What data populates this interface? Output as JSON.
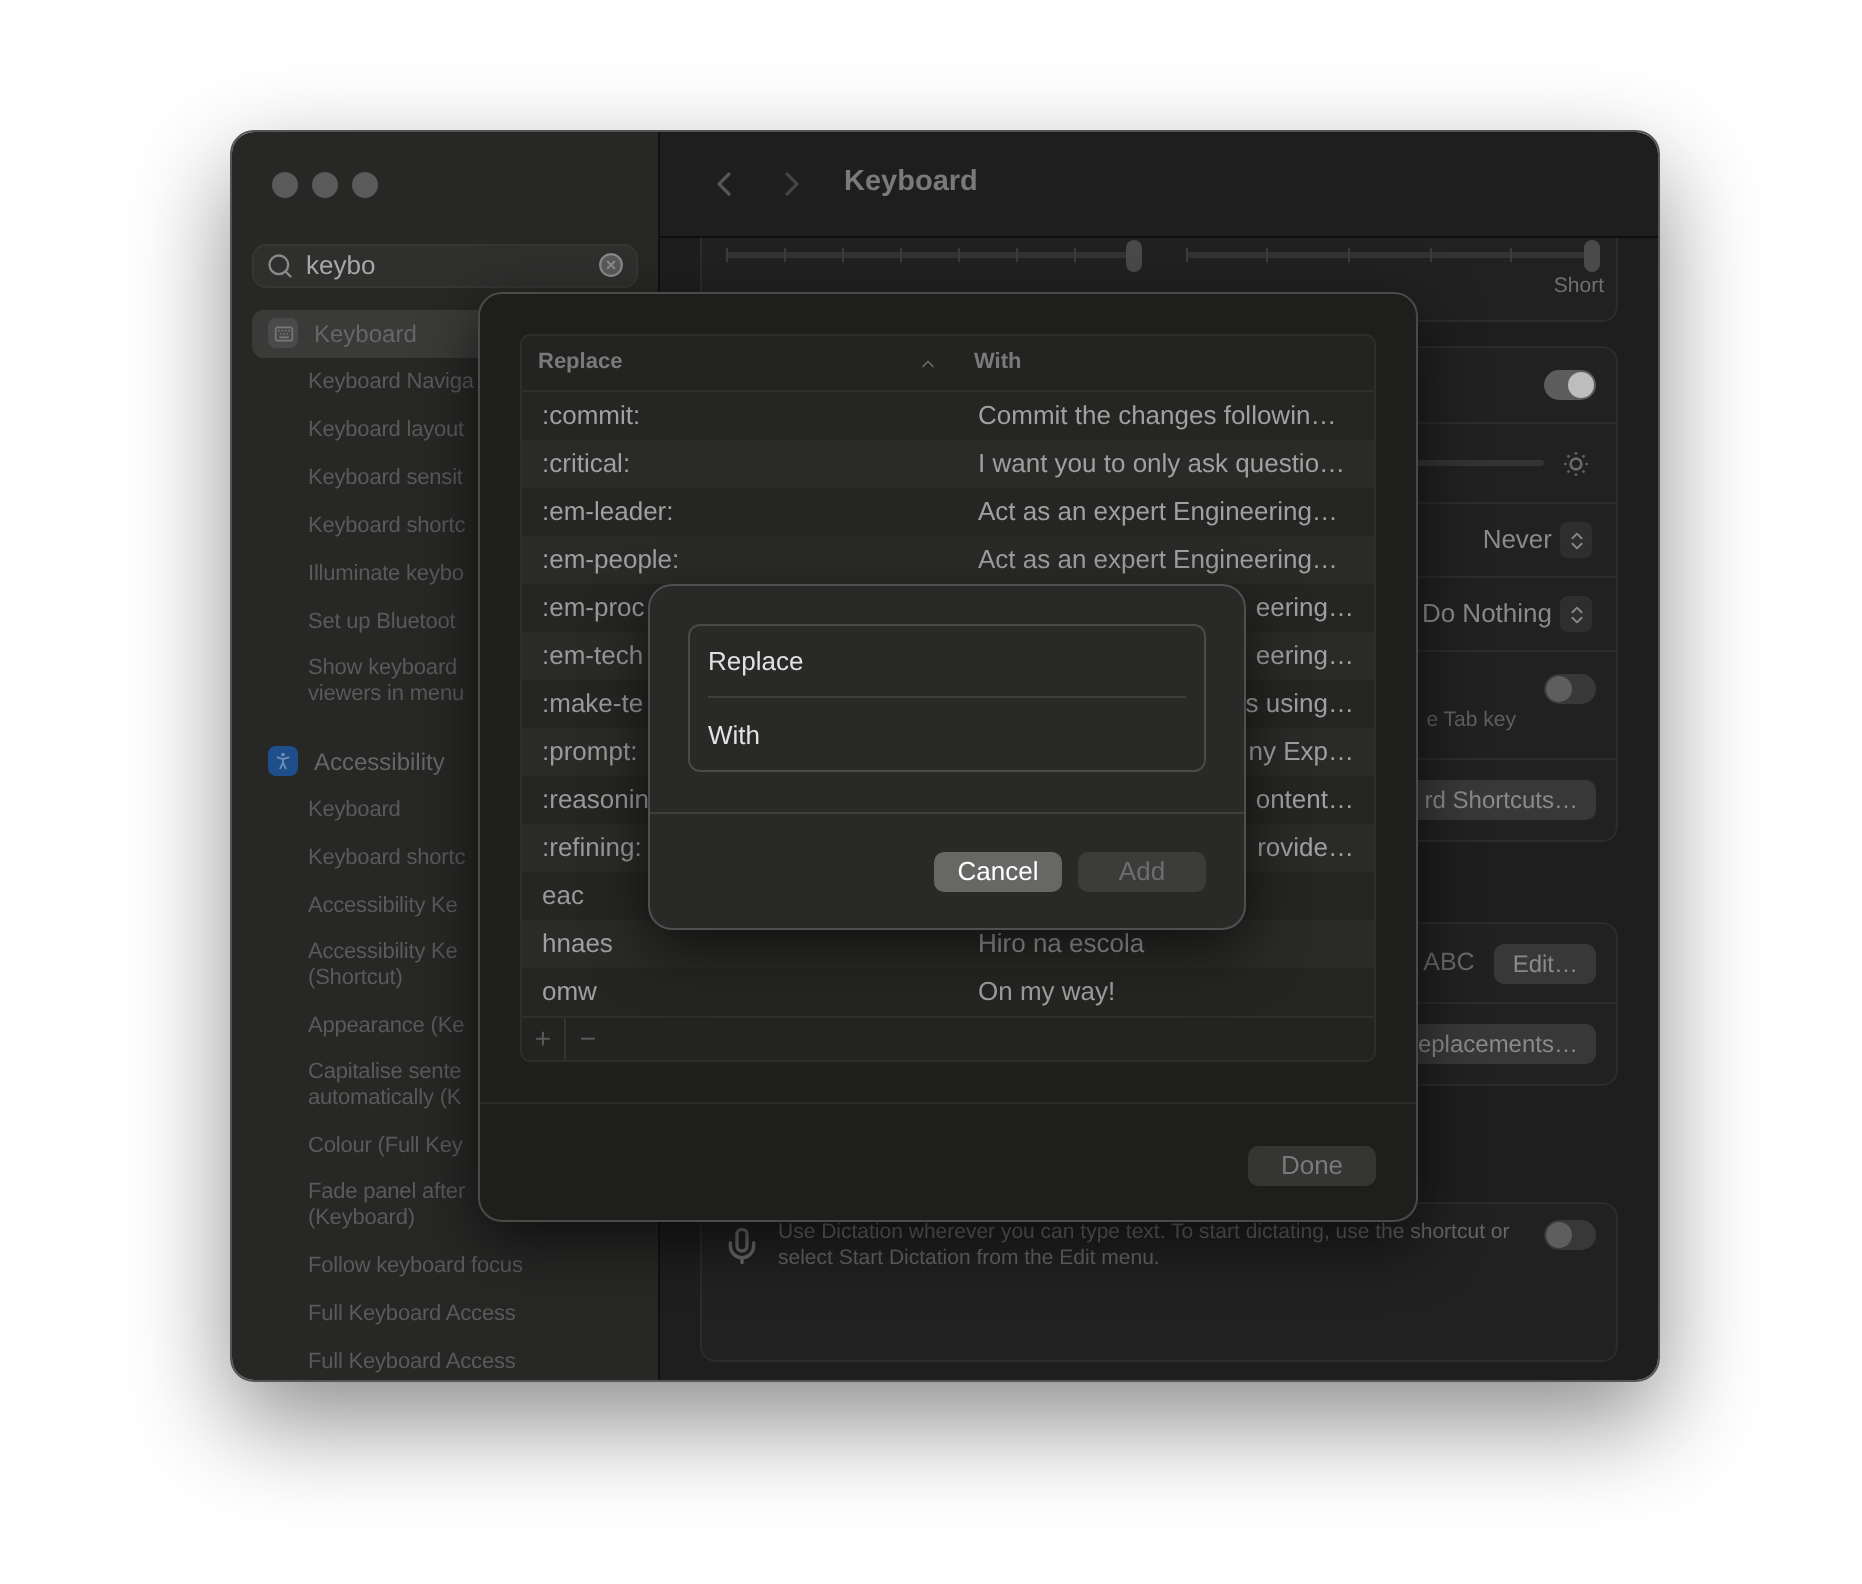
{
  "window": {
    "title": "Keyboard"
  },
  "search": {
    "value": "keybo"
  },
  "sidebar": {
    "groups": [
      {
        "label": "Keyboard",
        "selected": true,
        "items": [
          {
            "lines": [
              "Keyboard Naviga"
            ]
          },
          {
            "lines": [
              "Keyboard layout"
            ]
          },
          {
            "lines": [
              "Keyboard sensit"
            ]
          },
          {
            "lines": [
              "Keyboard shortc"
            ]
          },
          {
            "lines": [
              "Illuminate keybo"
            ]
          },
          {
            "lines": [
              "Set up Bluetoot"
            ]
          },
          {
            "lines": [
              "Show keyboard",
              "viewers in menu"
            ]
          }
        ]
      },
      {
        "label": "Accessibility",
        "selected": false,
        "items": [
          {
            "lines": [
              "Keyboard"
            ]
          },
          {
            "lines": [
              "Keyboard shortc"
            ]
          },
          {
            "lines": [
              "Accessibility Ke"
            ]
          },
          {
            "lines": [
              "Accessibility Ke",
              "(Shortcut)"
            ]
          },
          {
            "lines": [
              "Appearance (Ke"
            ]
          },
          {
            "lines": [
              "Capitalise sente",
              "automatically (K"
            ]
          },
          {
            "lines": [
              "Colour (Full Key"
            ]
          },
          {
            "lines": [
              "Fade panel after",
              "(Keyboard)"
            ]
          },
          {
            "lines": [
              "Follow keyboard focus"
            ]
          },
          {
            "lines": [
              "Full Keyboard Access"
            ]
          },
          {
            "lines": [
              "Full Keyboard Access"
            ]
          }
        ]
      }
    ]
  },
  "settings": {
    "sliders": [
      {
        "level": 1
      },
      {
        "level": 1,
        "label": "Short"
      }
    ]
  },
  "controls_card": {
    "rows": [
      {
        "kind": "toggle",
        "on": true
      },
      {
        "kind": "brightness"
      },
      {
        "kind": "select",
        "value": "Never"
      },
      {
        "kind": "select",
        "value": "Do Nothing"
      },
      {
        "kind": "toggle",
        "on": false,
        "note": "e Tab key"
      },
      {
        "kind": "button",
        "label": "rd Shortcuts…"
      }
    ]
  },
  "text_card": {
    "rows": [
      {
        "kind": "value_button",
        "value": "ABC",
        "label": "Edit…"
      },
      {
        "kind": "button",
        "label": "eplacements…"
      }
    ]
  },
  "dictation": {
    "text": "Use Dictation wherever you can type text. To start dictating, use the shortcut or select Start Dictation from the Edit menu.",
    "on": false
  },
  "sheet": {
    "columns": [
      {
        "label": "Replace",
        "sorted": true
      },
      {
        "label": "With",
        "sorted": false
      }
    ],
    "rows": [
      {
        "kind": "full",
        "replace": ":commit:",
        "with": "Commit the changes followin…"
      },
      {
        "kind": "full",
        "replace": ":critical:",
        "with": "I want you to only ask questio…"
      },
      {
        "kind": "full",
        "replace": ":em-leader:",
        "with": "Act as an expert Engineering…"
      },
      {
        "kind": "full",
        "replace": ":em-people:",
        "with": "Act as an expert Engineering…"
      },
      {
        "kind": "clipped",
        "replace": ":em-proc",
        "with": "eering…"
      },
      {
        "kind": "clipped",
        "replace": ":em-tech",
        "with": "eering…"
      },
      {
        "kind": "clipped",
        "replace": ":make-te",
        "with": "s using…"
      },
      {
        "kind": "clipped",
        "replace": ":prompt:",
        "with": "ny Exp…"
      },
      {
        "kind": "clipped",
        "replace": ":reasonin",
        "with": "ontent…"
      },
      {
        "kind": "clipped",
        "replace": ":refining:",
        "with": "rovide…"
      },
      {
        "kind": "clipped",
        "replace": "eac"
      },
      {
        "kind": "full",
        "replace": "hnaes",
        "with": "Hiro na escola"
      },
      {
        "kind": "full",
        "replace": "omw",
        "with": "On my way!"
      }
    ],
    "add": "+",
    "remove": "−",
    "done": "Done"
  },
  "alert": {
    "fields": [
      {
        "placeholder": "Replace"
      },
      {
        "placeholder": "With"
      }
    ],
    "buttons": [
      {
        "label": "Cancel",
        "disabled": false
      },
      {
        "label": "Add",
        "disabled": true
      }
    ]
  }
}
